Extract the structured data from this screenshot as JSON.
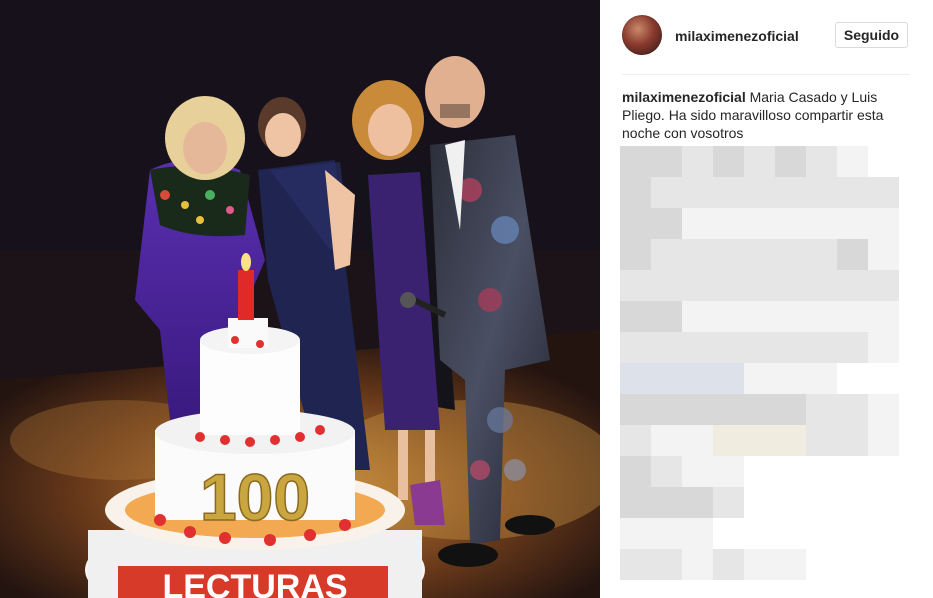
{
  "photo": {
    "alt_subject": "stage photo",
    "cake_text": "100",
    "cake_brand_text": "LECTURAS"
  },
  "post": {
    "username": "milaximenezoficial",
    "follow_label": "Seguido",
    "caption_user": "milaximenezoficial",
    "caption_text": "Maria Casado y Luis Pliego. Ha sido maravilloso compartir esta noche con vosotros"
  },
  "colors": {
    "text": "#262626",
    "border": "#dbdbdb",
    "divider": "#efefef",
    "blur_light": "#f2f2f2",
    "blur_mid": "#e2e2e2",
    "blur_dark": "#d2d2d2"
  },
  "comments": {
    "blurred": true,
    "pixel_rows": [
      [
        3,
        3,
        2,
        3,
        2,
        3,
        2,
        1,
        0
      ],
      [
        3,
        2,
        2,
        2,
        2,
        2,
        2,
        2,
        2
      ],
      [
        3,
        3,
        1,
        1,
        1,
        1,
        1,
        1,
        1
      ],
      [
        3,
        2,
        2,
        2,
        2,
        2,
        2,
        3,
        1
      ],
      [
        2,
        2,
        2,
        2,
        2,
        2,
        2,
        2,
        2
      ],
      [
        3,
        3,
        1,
        1,
        1,
        1,
        1,
        1,
        1
      ],
      [
        2,
        2,
        2,
        2,
        2,
        2,
        2,
        2,
        1
      ],
      [
        4,
        4,
        4,
        4,
        1,
        1,
        1,
        0,
        0
      ],
      [
        3,
        3,
        3,
        3,
        3,
        3,
        2,
        2,
        1
      ],
      [
        2,
        1,
        1,
        5,
        5,
        5,
        2,
        2,
        1
      ],
      [
        3,
        2,
        1,
        1,
        0,
        0,
        0,
        0,
        0
      ],
      [
        3,
        3,
        3,
        2,
        0,
        0,
        0,
        0,
        0
      ],
      [
        1,
        1,
        1,
        0,
        0,
        0,
        0,
        0,
        0
      ],
      [
        2,
        2,
        1,
        2,
        1,
        1,
        0,
        0,
        0
      ]
    ]
  }
}
